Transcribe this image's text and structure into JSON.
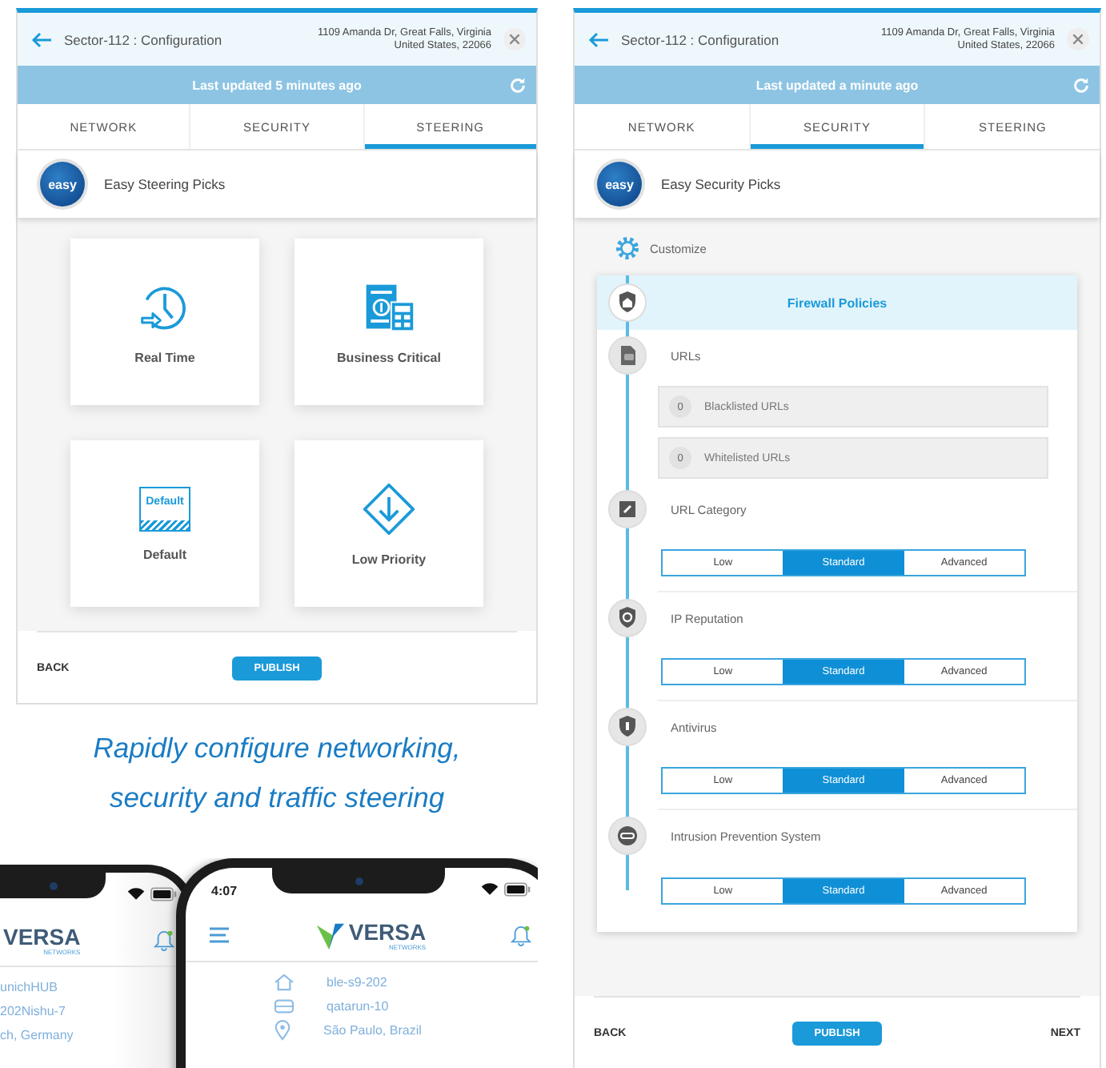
{
  "panels": [
    {
      "kind": "steering",
      "header": {
        "title": "Sector-112 : Configuration",
        "address": [
          "1109 Amanda Dr, Great Falls, Virginia",
          "United States, 22066"
        ]
      },
      "update_bar": {
        "text": "Last updated 5 minutes ago"
      },
      "tabs": [
        {
          "label": "NETWORK",
          "selected": false
        },
        {
          "label": "SECURITY",
          "selected": false
        },
        {
          "label": "STEERING",
          "selected": true
        }
      ],
      "easy": {
        "logo": "easy",
        "label": "Easy Steering Picks"
      },
      "picks": [
        {
          "label": "Real Time"
        },
        {
          "label": "Business Critical"
        },
        {
          "label": "Default",
          "icon_text": "Default"
        },
        {
          "label": "Low Priority"
        }
      ],
      "footer": {
        "back": "BACK",
        "publish": "PUBLISH"
      }
    },
    {
      "kind": "security",
      "header": {
        "title": "Sector-112 : Configuration",
        "address": [
          "1109 Amanda Dr, Great Falls, Virginia",
          "United States, 22066"
        ]
      },
      "update_bar": {
        "text": "Last updated a minute ago"
      },
      "tabs": [
        {
          "label": "NETWORK",
          "selected": false
        },
        {
          "label": "SECURITY",
          "selected": true
        },
        {
          "label": "STEERING",
          "selected": false
        }
      ],
      "easy": {
        "logo": "easy",
        "label": "Easy Security Picks"
      },
      "customize": "Customize",
      "policies": [
        {
          "kind": "header",
          "label": "Firewall Policies"
        },
        {
          "kind": "list",
          "label": "URLs",
          "items": [
            {
              "count": "0",
              "label": "Blacklisted URLs"
            },
            {
              "count": "0",
              "label": "Whitelisted URLs"
            }
          ]
        },
        {
          "kind": "levels",
          "label": "URL Category",
          "options": [
            {
              "label": "Low",
              "selected": false
            },
            {
              "label": "Standard",
              "selected": true
            },
            {
              "label": "Advanced",
              "selected": false
            }
          ]
        },
        {
          "kind": "levels",
          "label": "IP Reputation",
          "options": [
            {
              "label": "Low",
              "selected": false
            },
            {
              "label": "Standard",
              "selected": true
            },
            {
              "label": "Advanced",
              "selected": false
            }
          ]
        },
        {
          "kind": "levels",
          "label": "Antivirus",
          "options": [
            {
              "label": "Low",
              "selected": false
            },
            {
              "label": "Standard",
              "selected": true
            },
            {
              "label": "Advanced",
              "selected": false
            }
          ]
        },
        {
          "kind": "levels",
          "label": "Intrusion Prevention System",
          "options": [
            {
              "label": "Low",
              "selected": false
            },
            {
              "label": "Standard",
              "selected": true
            },
            {
              "label": "Advanced",
              "selected": false
            }
          ]
        }
      ],
      "footer": {
        "back": "BACK",
        "publish": "PUBLISH",
        "next": "NEXT"
      }
    }
  ],
  "caption": "Rapidly configure networking, security and traffic steering",
  "phones": [
    {
      "logo": "VERSA",
      "logo_sub": "NETWORKS",
      "rows": [
        "unichHUB",
        "202Nishu-7",
        "ch, Germany"
      ]
    },
    {
      "time": "4:07",
      "logo": "VERSA",
      "logo_sub": "NETWORKS",
      "rows": [
        "ble-s9-202",
        "qatarun-10",
        "São Paulo, Brazil"
      ]
    }
  ]
}
